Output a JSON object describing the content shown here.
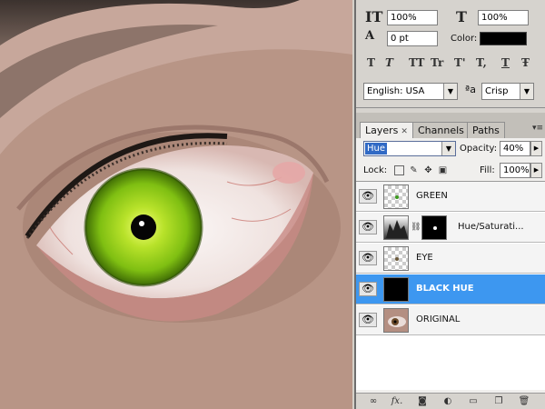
{
  "character": {
    "leading_value": "100%",
    "tracking_value": "100%",
    "baseline_value": "0 pt",
    "color_label": "Color:",
    "color": "#000000",
    "language_value": "English: USA",
    "aa_label": "a",
    "antialias_value": "Crisp",
    "style_buttons": [
      "T",
      "T",
      "TT",
      "Tr",
      "T'",
      "T,",
      "T",
      "Ŧ"
    ]
  },
  "layers_panel": {
    "tabs": [
      {
        "label": "Layers",
        "active": true
      },
      {
        "label": "Channels",
        "active": false
      },
      {
        "label": "Paths",
        "active": false
      }
    ],
    "blend_mode": "Hue",
    "opacity_label": "Opacity:",
    "opacity_value": "40%",
    "lock_label": "Lock:",
    "fill_label": "Fill:",
    "fill_value": "100%",
    "layers": [
      {
        "name": "GREEN",
        "visible": true,
        "selected": false
      },
      {
        "name": "Hue/Saturati...",
        "visible": true,
        "selected": false
      },
      {
        "name": "EYE",
        "visible": true,
        "selected": false
      },
      {
        "name": "BLACK HUE",
        "visible": true,
        "selected": true
      },
      {
        "name": "ORIGINAL",
        "visible": true,
        "selected": false
      }
    ]
  },
  "colors": {
    "selection": "#3d97f0",
    "iris": "#9ed61e",
    "panel_bg": "#d6d3ce"
  }
}
